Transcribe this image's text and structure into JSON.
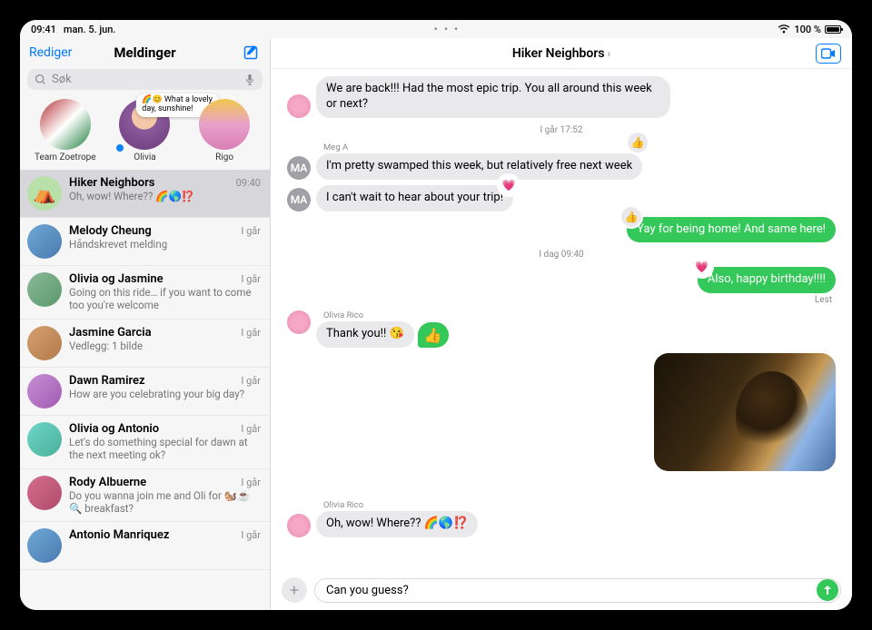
{
  "status": {
    "time": "09:41",
    "date": "man. 5. jun.",
    "dots": "• • •",
    "battery_pct": "100 %",
    "wifi": "􀙇"
  },
  "sidebar": {
    "edit": "Rediger",
    "title": "Meldinger",
    "search_placeholder": "Søk",
    "pinned": [
      {
        "label": "Team Zoetrope"
      },
      {
        "label": "Olivia",
        "bubble": "🌈😊 What a lovely day, sunshine!",
        "unread": true
      },
      {
        "label": "Rigo"
      }
    ],
    "conversations": [
      {
        "name": "Hiker Neighbors",
        "preview": "Oh, wow! Where?? 🌈🌎⁉️",
        "time": "09:40",
        "active": true,
        "avatar": "tent"
      },
      {
        "name": "Melody Cheung",
        "preview": "Håndskrevet melding",
        "time": "I går",
        "avatar": "5"
      },
      {
        "name": "Olivia og Jasmine",
        "preview": "Going on this ride… if you want to come too you're welcome",
        "time": "I går",
        "avatar": "6"
      },
      {
        "name": "Jasmine Garcia",
        "preview": "Vedlegg: 1 bilde",
        "time": "I går",
        "avatar": "7"
      },
      {
        "name": "Dawn Ramirez",
        "preview": "How are you celebrating your big day?",
        "time": "I går",
        "avatar": "8"
      },
      {
        "name": "Olivia og Antonio",
        "preview": "Let's do something special for dawn at the next meeting ok?",
        "time": "I går",
        "avatar": "9"
      },
      {
        "name": "Rody Albuerne",
        "preview": "Do you wanna join me and Oli for 🐿️☕🔍 breakfast?",
        "time": "I går",
        "avatar": "10"
      },
      {
        "name": "Antonio Manriquez",
        "preview": "",
        "time": "I går",
        "avatar": "5"
      }
    ]
  },
  "main": {
    "title": "Hiker Neighbors",
    "timestamps": {
      "yesterday": "I går 17:52",
      "today": "I dag 09:40"
    },
    "messages": {
      "m0": "We are back!!! Had the most epic trip. You all around this week or next?",
      "m1_sender": "Meg A",
      "m1": "I'm pretty swamped this week, but relatively free next week",
      "m2": "I can't wait to hear about your trip!",
      "m3": "Yay for being home! And same here!",
      "m4": "Also, happy birthday!!!!",
      "m4_status": "Lest",
      "m5_sender": "Olivia Rico",
      "m5": "Thank you!! 😘",
      "m6_sender": "Olivia Rico",
      "m6": "Oh, wow! Where?? 🌈🌎⁉️"
    },
    "compose_value": "Can you guess?"
  }
}
